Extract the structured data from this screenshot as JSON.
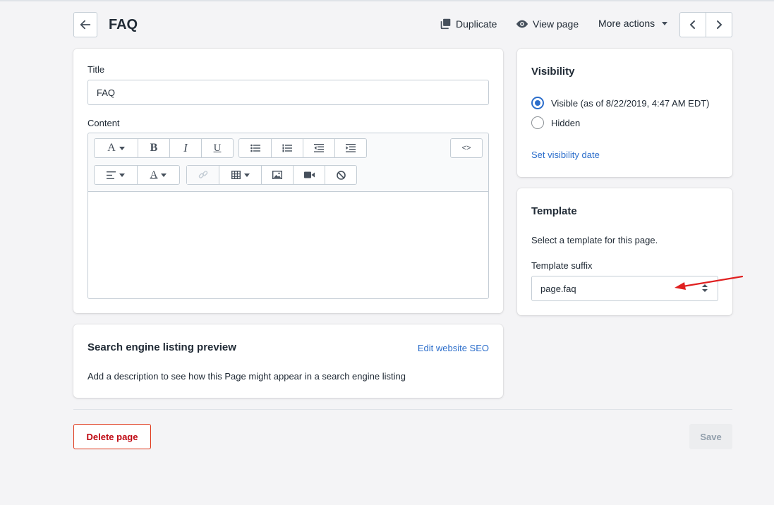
{
  "header": {
    "title": "FAQ",
    "duplicate_label": "Duplicate",
    "view_page_label": "View page",
    "more_actions_label": "More actions"
  },
  "main": {
    "title_label": "Title",
    "title_value": "FAQ",
    "content_label": "Content",
    "html_toggle_label": "<>"
  },
  "seo": {
    "heading": "Search engine listing preview",
    "edit_link": "Edit website SEO",
    "description": "Add a description to see how this Page might appear in a search engine listing"
  },
  "visibility": {
    "heading": "Visibility",
    "options": [
      {
        "label": "Visible (as of 8/22/2019, 4:47 AM EDT)",
        "checked": true
      },
      {
        "label": "Hidden",
        "checked": false
      }
    ],
    "set_date_link": "Set visibility date"
  },
  "template": {
    "heading": "Template",
    "description": "Select a template for this page.",
    "suffix_label": "Template suffix",
    "suffix_value": "page.faq"
  },
  "footer": {
    "delete_label": "Delete page",
    "save_label": "Save"
  },
  "colors": {
    "accent": "#2c6ecb",
    "danger": "#de3618",
    "annotation_arrow": "#e02020"
  },
  "icons": [
    "arrow-left-icon",
    "duplicate-icon",
    "eye-icon",
    "chevron-left-icon",
    "chevron-right-icon"
  ]
}
